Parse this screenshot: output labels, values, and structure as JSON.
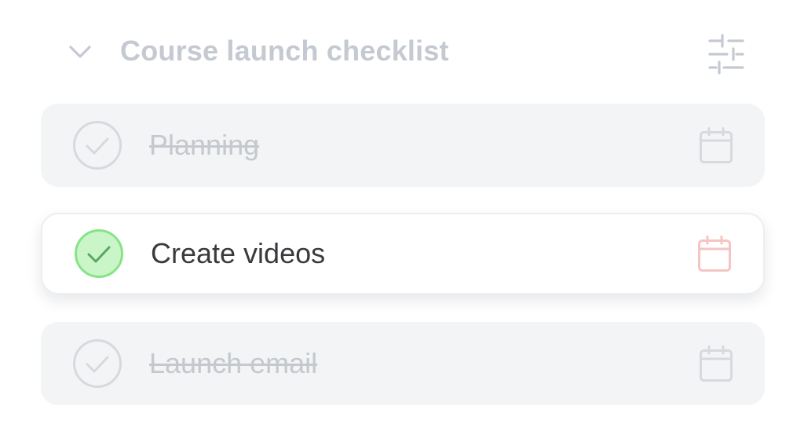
{
  "checklist": {
    "title": "Course launch checklist",
    "collapse_icon": "chevron-down-icon",
    "settings_icon": "sliders-icon",
    "tasks": [
      {
        "label": "Planning",
        "completed": true,
        "due_icon": "calendar-icon"
      },
      {
        "label": "Create videos",
        "completed": false,
        "highlighted": true,
        "due_icon": "calendar-icon"
      },
      {
        "label": "Launch email",
        "completed": true,
        "due_icon": "calendar-icon"
      }
    ]
  },
  "colors": {
    "title": "#c4c9d2",
    "completed_card": "#f3f4f6",
    "completed_text": "#c5c8cd",
    "active_text": "#3a3a3e",
    "check_active_fill": "#c9f5c9",
    "check_active_stroke": "#86e486",
    "calendar_active": "#f6c4c2",
    "muted_icon": "#d6d9de"
  }
}
